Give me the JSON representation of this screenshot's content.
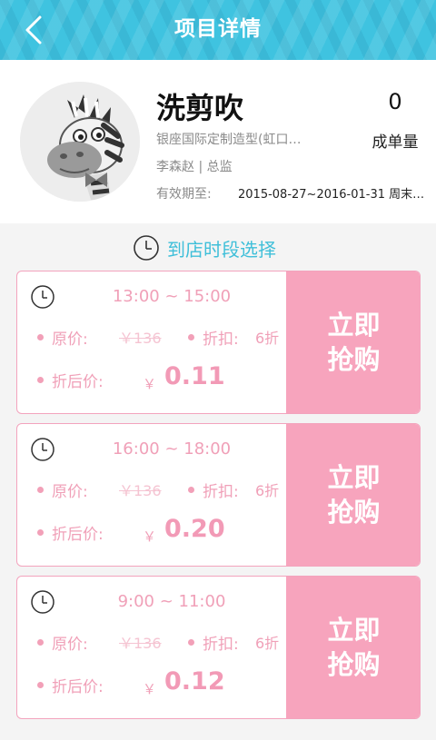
{
  "header": {
    "title": "项目详情"
  },
  "profile": {
    "name": "洗剪吹",
    "address": "银座国际定制造型(虹口…",
    "staff": "李森赵 | 总监",
    "validity_label": "有效期至:",
    "validity_value": "2015-08-27~2016-01-31 周末…",
    "order_count": "0",
    "order_label": "成单量"
  },
  "section": {
    "title": "到店时段选择"
  },
  "slots": [
    {
      "time": "13:00 ~ 15:00",
      "orig_label": "原价:",
      "orig_price": "￥136",
      "discount_label": "折扣:",
      "discount": "6折",
      "final_label": "折后价:",
      "currency": "￥",
      "final_price": "0.11",
      "buy_label": "立即抢购"
    },
    {
      "time": "16:00 ~ 18:00",
      "orig_label": "原价:",
      "orig_price": "￥136",
      "discount_label": "折扣:",
      "discount": "6折",
      "final_label": "折后价:",
      "currency": "￥",
      "final_price": "0.20",
      "buy_label": "立即抢购"
    },
    {
      "time": "9:00 ~ 11:00",
      "orig_label": "原价:",
      "orig_price": "￥136",
      "discount_label": "折扣:",
      "discount": "6折",
      "final_label": "折后价:",
      "currency": "￥",
      "final_price": "0.12",
      "buy_label": "立即抢购"
    }
  ],
  "colors": {
    "header": "#3fc3e0",
    "accent_pink": "#f7a4bd",
    "section_title": "#3fbfd9"
  },
  "icons": {
    "back": "chevron-left-icon",
    "clock": "clock-icon",
    "avatar": "zebra-avatar"
  }
}
